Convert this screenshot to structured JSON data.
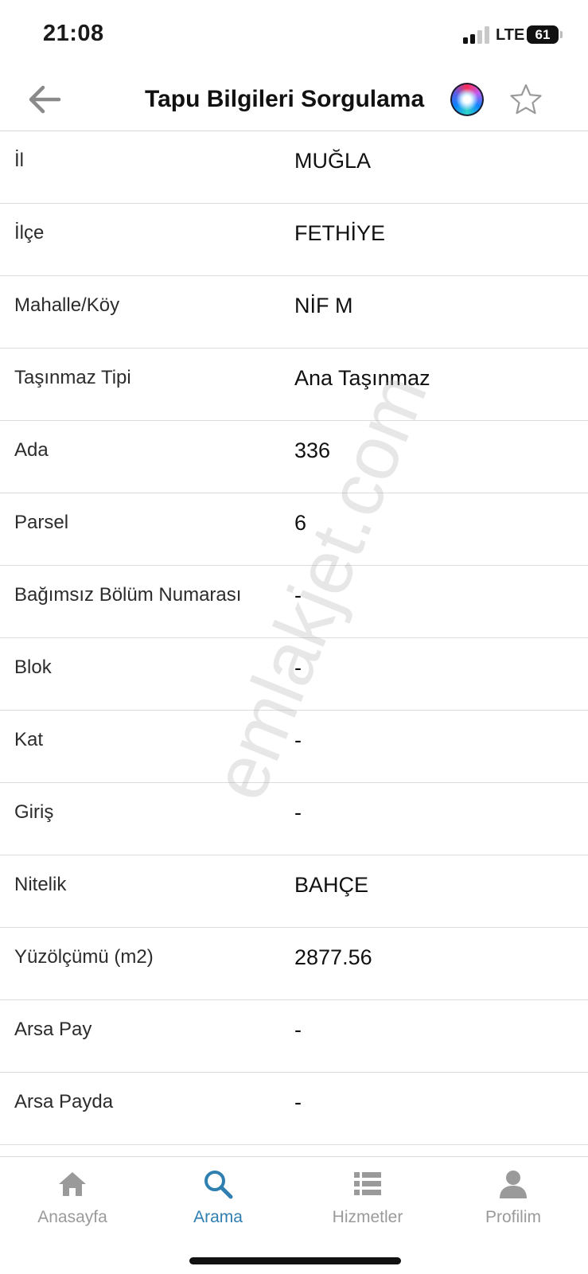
{
  "status_bar": {
    "time": "21:08",
    "network": "LTE",
    "battery": "61"
  },
  "nav": {
    "title": "Tapu Bilgileri Sorgulama"
  },
  "rows": [
    {
      "label": "İl",
      "value": "MUĞLA"
    },
    {
      "label": "İlçe",
      "value": "FETHİYE"
    },
    {
      "label": "Mahalle/Köy",
      "value": "NİF M"
    },
    {
      "label": "Taşınmaz Tipi",
      "value": "Ana Taşınmaz"
    },
    {
      "label": "Ada",
      "value": "336"
    },
    {
      "label": "Parsel",
      "value": "6"
    },
    {
      "label": "Bağımsız Bölüm Numarası",
      "value": "-"
    },
    {
      "label": "Blok",
      "value": "-"
    },
    {
      "label": "Kat",
      "value": "-"
    },
    {
      "label": "Giriş",
      "value": "-"
    },
    {
      "label": "Nitelik",
      "value": "BAHÇE"
    },
    {
      "label": "Yüzölçümü (m2)",
      "value": "2877.56"
    },
    {
      "label": "Arsa Pay",
      "value": "-"
    },
    {
      "label": "Arsa Payda",
      "value": "-"
    }
  ],
  "watermark": "emlakjet.com",
  "tabs": [
    {
      "label": "Anasayfa",
      "icon": "home-icon",
      "active": false
    },
    {
      "label": "Arama",
      "icon": "search-icon",
      "active": true
    },
    {
      "label": "Hizmetler",
      "icon": "list-icon",
      "active": false
    },
    {
      "label": "Profilim",
      "icon": "person-icon",
      "active": false
    }
  ],
  "colors": {
    "accent": "#2f7fb0",
    "inactive": "#9a9a9a",
    "divider": "#dcdcdc"
  }
}
